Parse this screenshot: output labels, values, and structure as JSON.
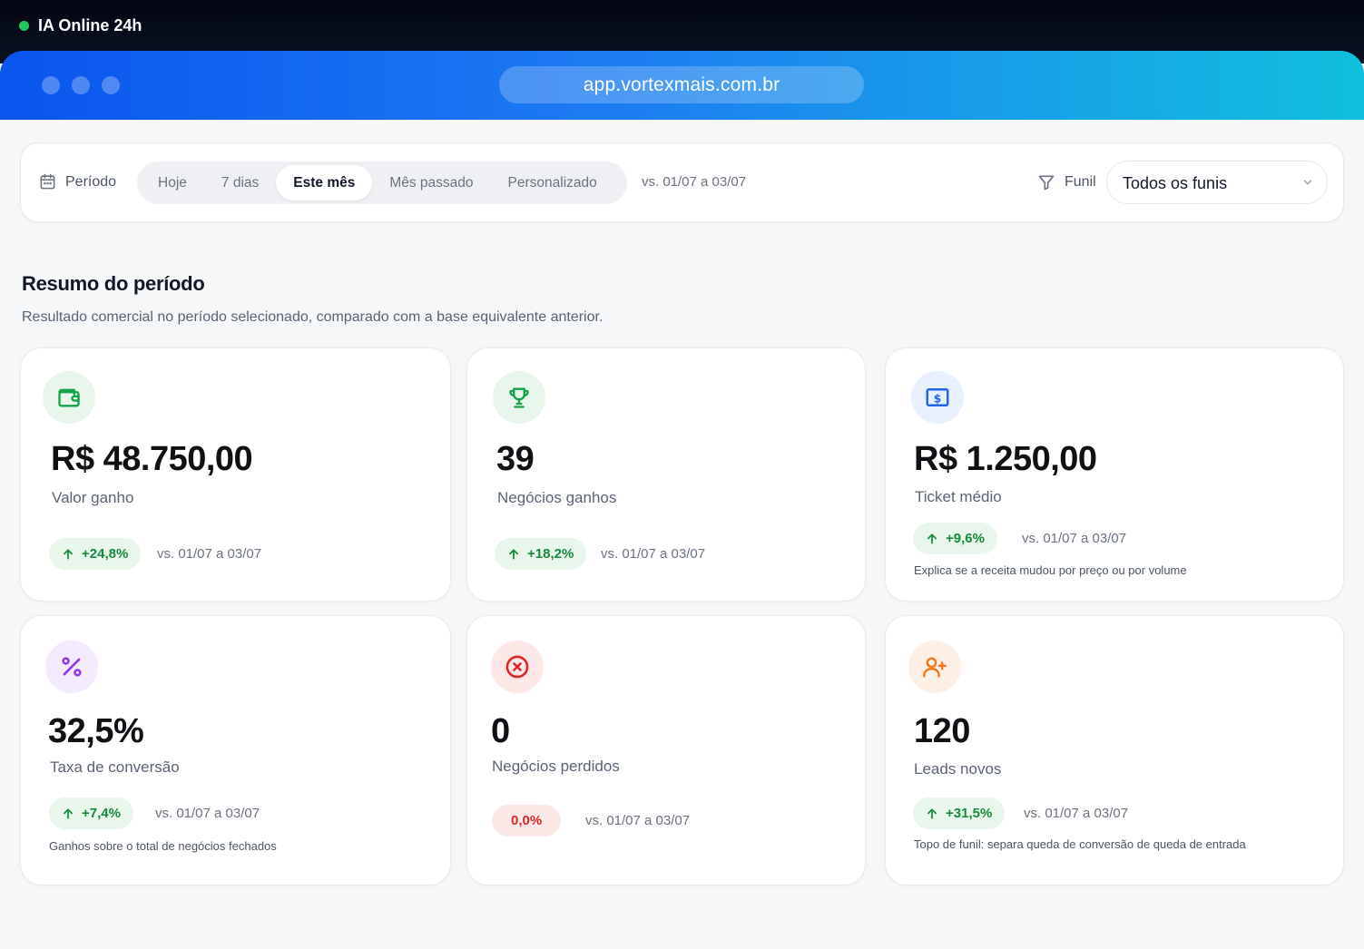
{
  "status": {
    "label": "IA Online 24h",
    "color": "#22c55e"
  },
  "browser": {
    "url": "app.vortexmais.com.br"
  },
  "filters": {
    "period_label": "Período",
    "period_icon": "calendar-icon",
    "tabs": [
      "Hoje",
      "7 dias",
      "Este mês",
      "Mês passado",
      "Personalizado"
    ],
    "active_tab": "Este mês",
    "compare": "vs. 01/07 a 03/07",
    "funnel_label": "Funil",
    "funnel_icon": "filter-icon",
    "funnel_value": "Todos os funis"
  },
  "summary": {
    "title": "Resumo do período",
    "subtitle": "Resultado comercial no período selecionado, comparado com a base equivalente anterior."
  },
  "cards": [
    {
      "icon": "wallet-icon",
      "value": "R$ 48.750,00",
      "label": "Valor ganho",
      "delta": "+24,8%",
      "trend": "up",
      "compare": "vs. 01/07 a 03/07",
      "note": ""
    },
    {
      "icon": "trophy-icon",
      "value": "39",
      "label": "Negócios ganhos",
      "delta": "+18,2%",
      "trend": "up",
      "compare": "vs. 01/07 a 03/07",
      "note": ""
    },
    {
      "icon": "ticket-icon",
      "value": "R$ 1.250,00",
      "label": "Ticket médio",
      "delta": "+9,6%",
      "trend": "up",
      "compare": "vs. 01/07 a 03/07",
      "note": "Explica se a receita mudou por preço ou por volume"
    },
    {
      "icon": "percent-icon",
      "value": "32,5%",
      "label": "Taxa de conversão",
      "delta": "+7,4%",
      "trend": "up",
      "compare": "vs. 01/07 a 03/07",
      "note": "Ganhos sobre o total de negócios fechados"
    },
    {
      "icon": "x-circle-icon",
      "value": "0",
      "label": "Negócios perdidos",
      "delta": "0,0%",
      "trend": "neutral",
      "compare": "vs. 01/07 a 03/07",
      "note": ""
    },
    {
      "icon": "user-plus-icon",
      "value": "120",
      "label": "Leads novos",
      "delta": "+31,5%",
      "trend": "up",
      "compare": "vs. 01/07 a 03/07",
      "note": "Topo de funil: separa queda de conversão de queda de entrada"
    }
  ],
  "colors": {
    "accent_green": "#178a3b",
    "accent_red": "#dc2626",
    "wallet": "#16a34a",
    "trophy": "#16a34a",
    "ticket": "#2563eb",
    "percent": "#9333ea",
    "x_circle": "#dc2626",
    "user_plus": "#f97316"
  }
}
